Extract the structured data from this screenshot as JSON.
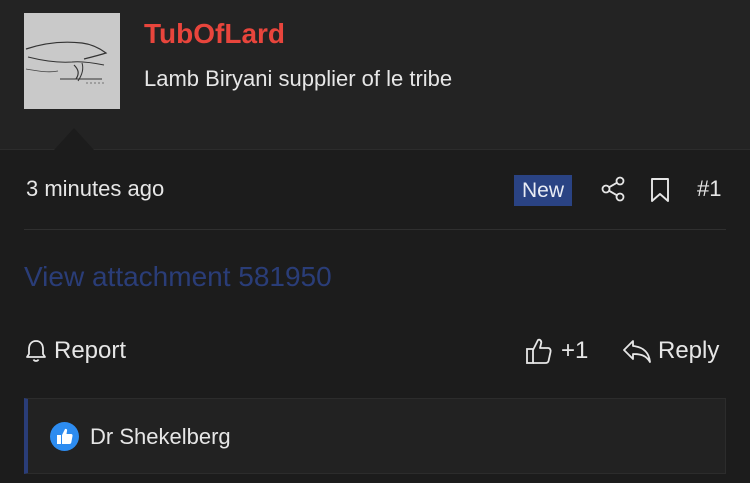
{
  "user": {
    "name": "TubOfLard",
    "title": "Lamb Biryani supplier of le tribe",
    "avatar_icon": "avatar-sketch",
    "name_color": "#e8453c"
  },
  "post": {
    "timestamp": "3 minutes ago",
    "badge": "New",
    "number": "#1",
    "share_icon": "share-icon",
    "bookmark_icon": "bookmark-icon"
  },
  "content": {
    "attachment_label": "View attachment 581950"
  },
  "actions": {
    "report_label": "Report",
    "like_count": "+1",
    "reply_label": "Reply"
  },
  "reactions": {
    "icon": "thumbs-up-reaction-icon",
    "users": "Dr Shekelberg"
  },
  "colors": {
    "background": "#1c1c1c",
    "accent": "#2a4384",
    "link": "#2a3d78"
  }
}
